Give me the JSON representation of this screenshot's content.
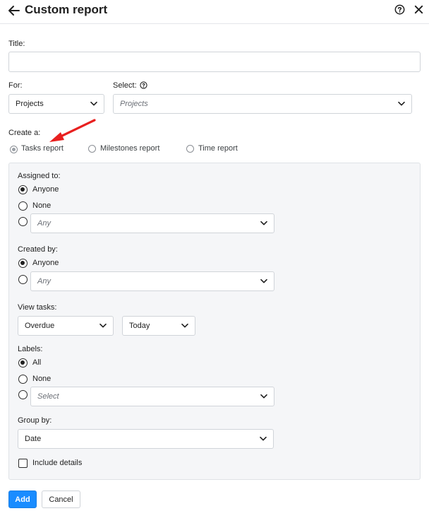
{
  "header": {
    "title": "Custom report",
    "icons": {
      "back": "arrow-left-icon",
      "help": "help-circle-icon",
      "close": "close-icon"
    }
  },
  "form": {
    "title_label": "Title:",
    "title_value": "",
    "for_label": "For:",
    "for_value": "Projects",
    "select_label": "Select:",
    "select_placeholder": "Projects",
    "create_label": "Create a:",
    "report_types": [
      {
        "label": "Tasks report",
        "selected": true
      },
      {
        "label": "Milestones report",
        "selected": false
      },
      {
        "label": "Time report",
        "selected": false
      }
    ]
  },
  "panel": {
    "assigned": {
      "label": "Assigned to:",
      "options": [
        "Anyone",
        "None"
      ],
      "selected": "Anyone",
      "custom_placeholder": "Any"
    },
    "created": {
      "label": "Created by:",
      "options": [
        "Anyone"
      ],
      "selected": "Anyone",
      "custom_placeholder": "Any"
    },
    "view": {
      "label": "View tasks:",
      "status_value": "Overdue",
      "date_value": "Today"
    },
    "labels": {
      "label": "Labels:",
      "options": [
        "All",
        "None"
      ],
      "selected": "All",
      "custom_placeholder": "Select"
    },
    "group": {
      "label": "Group by:",
      "value": "Date"
    },
    "include_details": {
      "label": "Include details",
      "checked": false
    }
  },
  "footer": {
    "add_label": "Add",
    "cancel_label": "Cancel"
  },
  "colors": {
    "primary": "#1a8cff",
    "annotation_arrow": "#e8201f",
    "panel_bg": "#f5f6f8"
  }
}
